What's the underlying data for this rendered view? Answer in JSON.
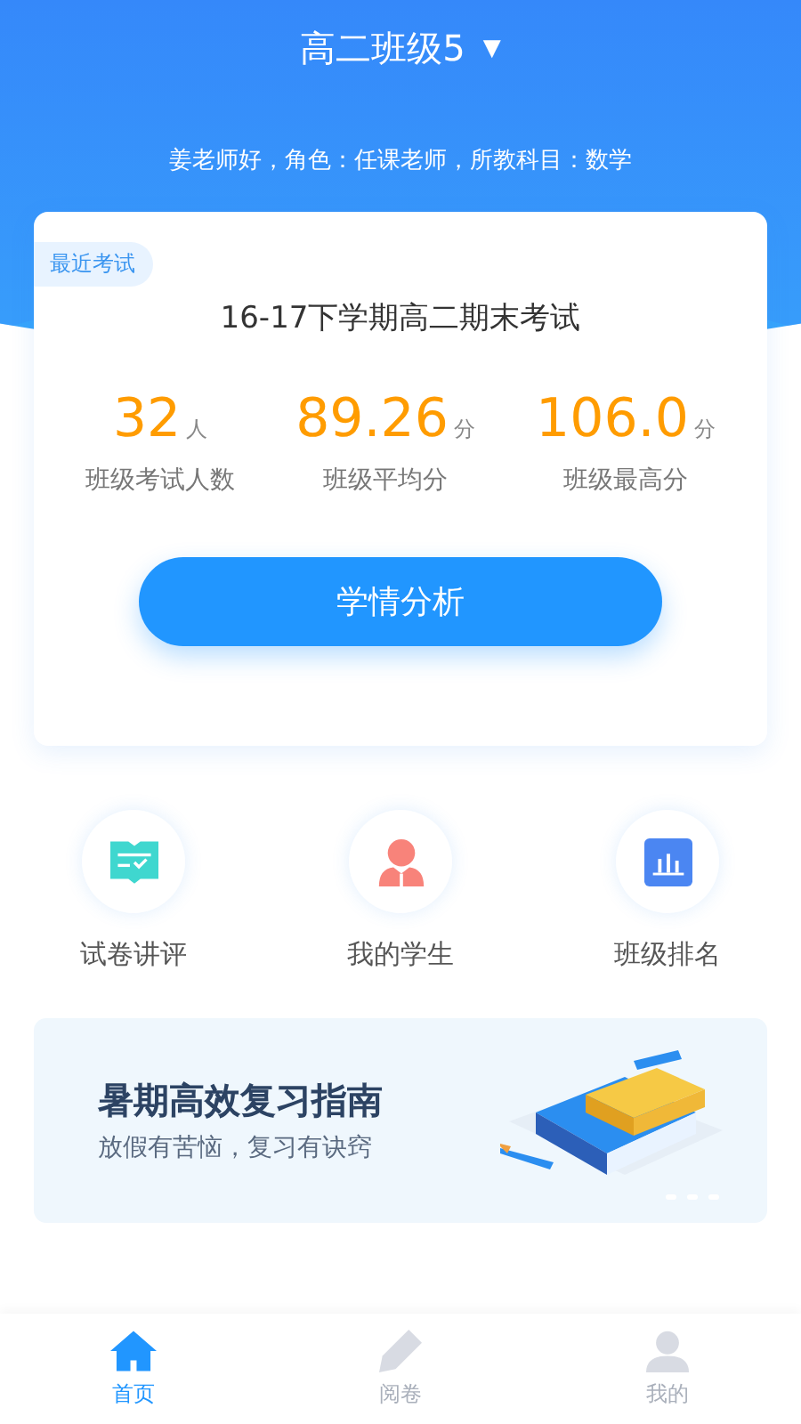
{
  "header": {
    "class_name": "高二班级5",
    "dropdown": "▼",
    "greeting": "姜老师好，角色：任课老师，所教科目：数学"
  },
  "exam_card": {
    "tag": "最近考试",
    "title": "16-17下学期高二期末考试",
    "stats": [
      {
        "value": "32",
        "unit": "人",
        "label": "班级考试人数"
      },
      {
        "value": "89.26",
        "unit": "分",
        "label": "班级平均分"
      },
      {
        "value": "106.0",
        "unit": "分",
        "label": "班级最高分"
      }
    ],
    "button": "学情分析"
  },
  "shortcuts": [
    {
      "kind": "paper",
      "label": "试卷讲评"
    },
    {
      "kind": "student",
      "label": "我的学生"
    },
    {
      "kind": "ranking",
      "label": "班级排名"
    }
  ],
  "banner": {
    "title": "暑期高效复习指南",
    "subtitle": "放假有苦恼，复习有诀窍"
  },
  "tab_bar": [
    {
      "kind": "home",
      "label": "首页",
      "selected": true
    },
    {
      "kind": "pen",
      "label": "阅卷",
      "selected": false
    },
    {
      "kind": "person",
      "label": "我的",
      "selected": false
    }
  ]
}
